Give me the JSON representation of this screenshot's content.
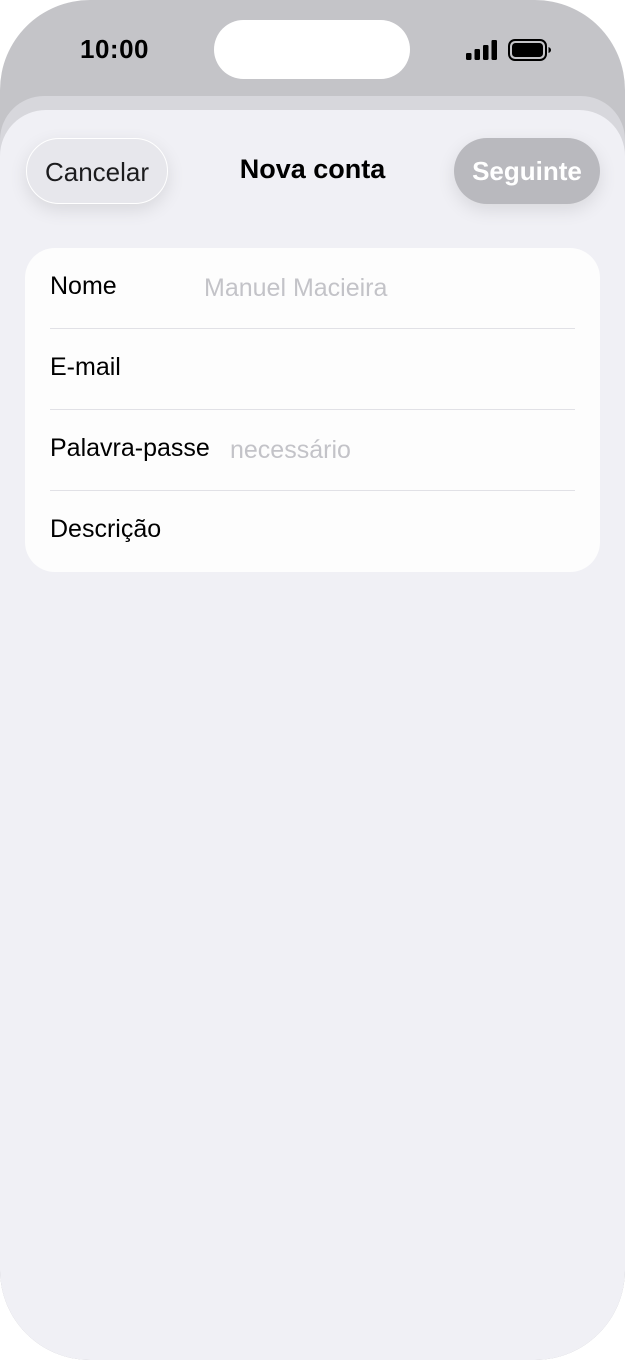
{
  "status_bar": {
    "time": "10:00",
    "signal_icon": "cellular-signal-icon",
    "battery_icon": "battery-icon"
  },
  "nav": {
    "cancel_label": "Cancelar",
    "title": "Nova conta",
    "next_label": "Seguinte"
  },
  "form": {
    "fields": [
      {
        "label": "Nome",
        "value": "",
        "placeholder": "Manuel Macieira"
      },
      {
        "label": "E-mail",
        "value": "",
        "placeholder": ""
      },
      {
        "label": "Palavra-passe",
        "value": "",
        "placeholder": "necessário"
      },
      {
        "label": "Descrição",
        "value": "",
        "placeholder": ""
      }
    ]
  },
  "colors": {
    "background": "#f0f0f5",
    "card": "#fdfdfd",
    "next_button_disabled": "#b9b9be",
    "placeholder": "#c3c3c8"
  }
}
